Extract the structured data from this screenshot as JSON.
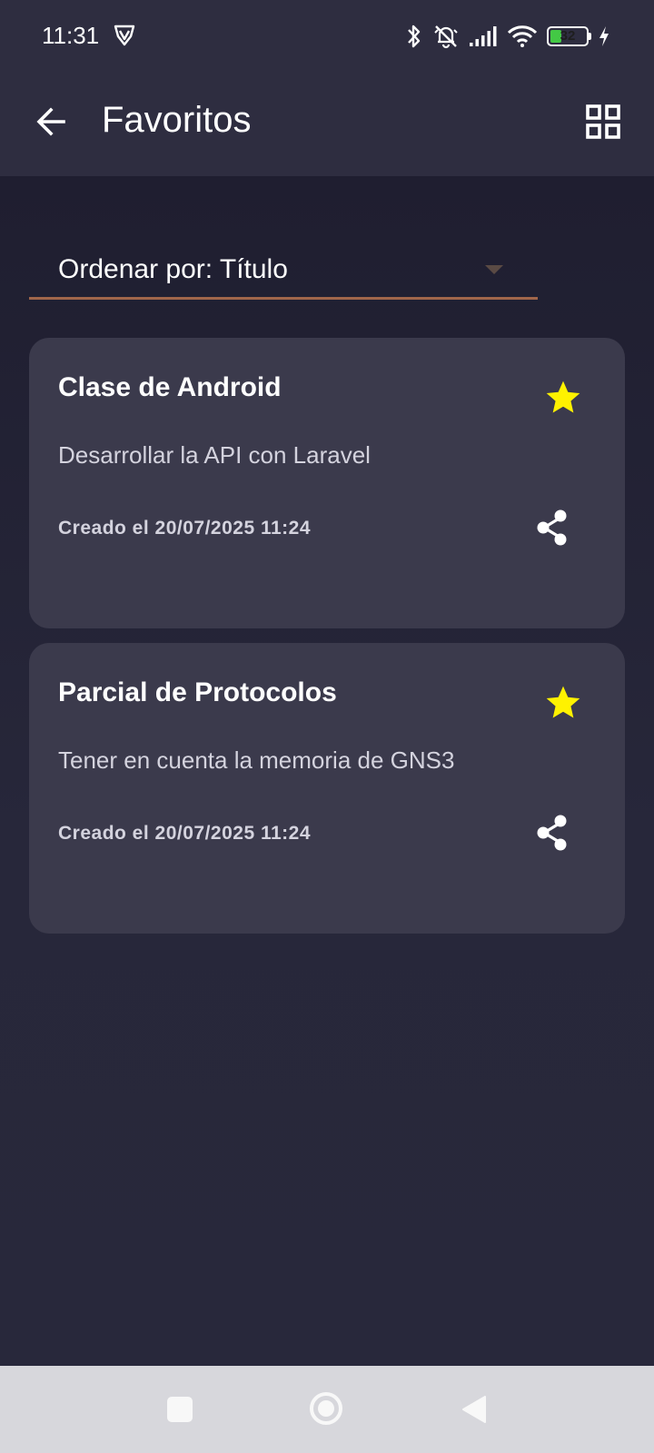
{
  "status_bar": {
    "time": "11:31",
    "battery_level": "32",
    "battery_fraction": 0.32,
    "icons": [
      "vpn-shield-icon",
      "bluetooth-icon",
      "notifications-off-icon",
      "signal-icon",
      "wifi-icon",
      "battery-icon",
      "charging-bolt-icon"
    ]
  },
  "app_bar": {
    "title": "Favoritos",
    "back_icon": "arrow-back-icon",
    "layout_icon": "grid-view-icon"
  },
  "sort": {
    "label": "Ordenar por: Título"
  },
  "notes": [
    {
      "title": "Clase de Android",
      "description": "Desarrollar la API con Laravel",
      "created": "Creado el 20/07/2025 11:24",
      "favorite": true
    },
    {
      "title": "Parcial de Protocolos",
      "description": "Tener en cuenta la memoria de GNS3",
      "created": "Creado el 20/07/2025 11:24",
      "favorite": true
    }
  ],
  "nav_bar": {
    "icons": [
      "recents-square-icon",
      "home-circle-icon",
      "back-triangle-icon"
    ]
  },
  "colors": {
    "app_bar_bg": "#2e2d40",
    "content_bg": "#262639",
    "card_bg": "#3b3a4c",
    "star": "#fff200",
    "sort_underline": "#a0664a",
    "battery_fill": "#43c945"
  }
}
